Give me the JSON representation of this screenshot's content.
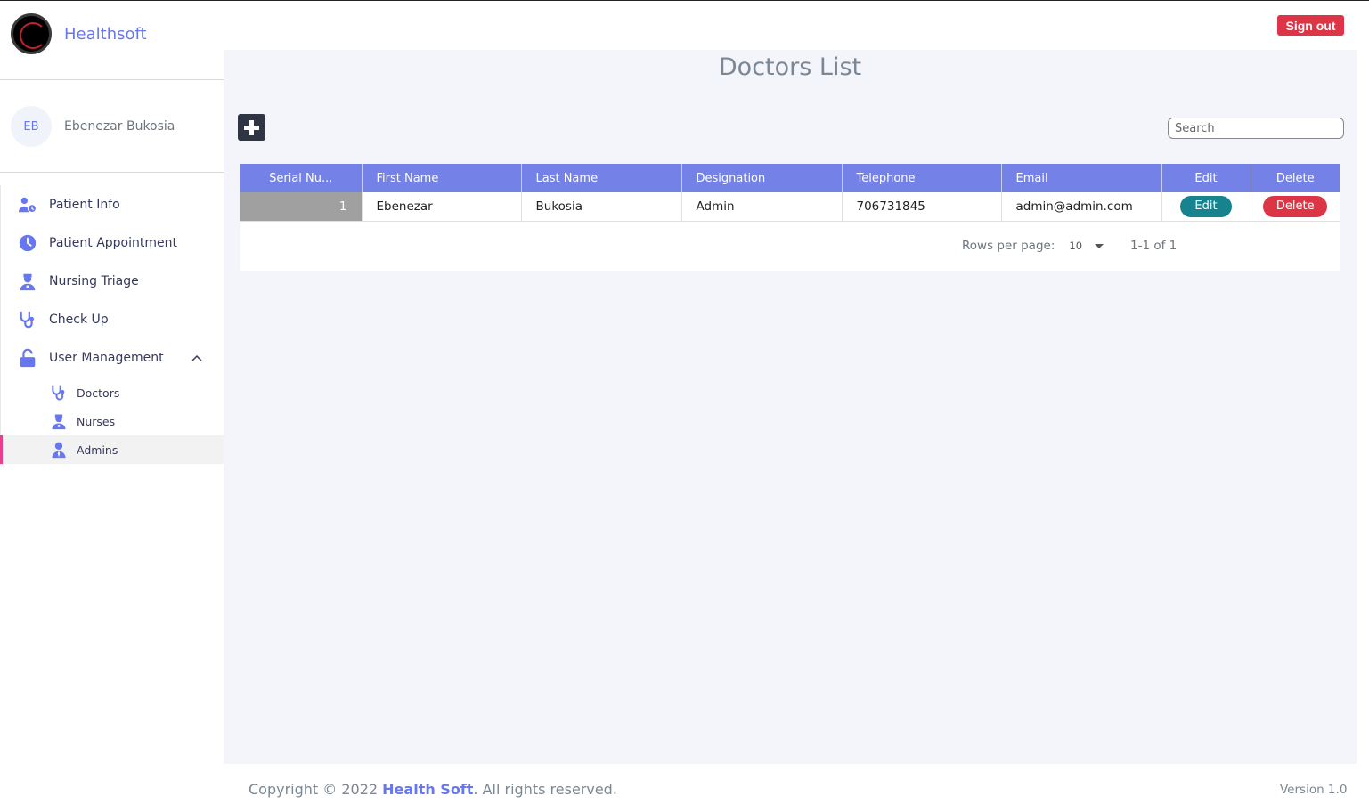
{
  "app": {
    "brand_name": "Healthsoft",
    "sign_out_label": "Sign out"
  },
  "user": {
    "initials": "EB",
    "name": "Ebenezar Bukosia"
  },
  "sidebar": {
    "items": [
      {
        "label": "Patient Info",
        "icon": "user-clock-icon"
      },
      {
        "label": "Patient Appointment",
        "icon": "clock-icon"
      },
      {
        "label": "Nursing Triage",
        "icon": "nurse-icon"
      },
      {
        "label": "Check Up",
        "icon": "stethoscope-icon"
      },
      {
        "label": "User Management",
        "icon": "unlock-icon",
        "expanded": true
      }
    ],
    "sub_items": [
      {
        "label": "Doctors",
        "icon": "stethoscope-icon"
      },
      {
        "label": "Nurses",
        "icon": "nurse-icon"
      },
      {
        "label": "Admins",
        "icon": "user-tie-icon",
        "active": true
      }
    ]
  },
  "main": {
    "title": "Doctors List",
    "search_placeholder": "Search",
    "table": {
      "columns": [
        "Serial Nu...",
        "First Name",
        "Last Name",
        "Designation",
        "Telephone",
        "Email",
        "Edit",
        "Delete"
      ],
      "rows": [
        {
          "serial": "1",
          "first_name": "Ebenezar",
          "last_name": "Bukosia",
          "designation": "Admin",
          "telephone": "706731845",
          "email": "admin@admin.com",
          "edit_label": "Edit",
          "delete_label": "Delete"
        }
      ]
    },
    "pagination": {
      "rows_per_page_label": "Rows per page:",
      "rows_per_page_value": "10",
      "range_text": "1-1 of 1"
    }
  },
  "footer": {
    "copyright_prefix": "Copyright © 2022 ",
    "brand": "Health Soft",
    "copyright_suffix": ". All rights reserved.",
    "version": "Version 1.0"
  },
  "colors": {
    "accent": "#6777ef",
    "header_row": "#7481e6",
    "danger": "#dc3545",
    "edit": "#17838f",
    "active_indicator": "#e83e8c"
  }
}
